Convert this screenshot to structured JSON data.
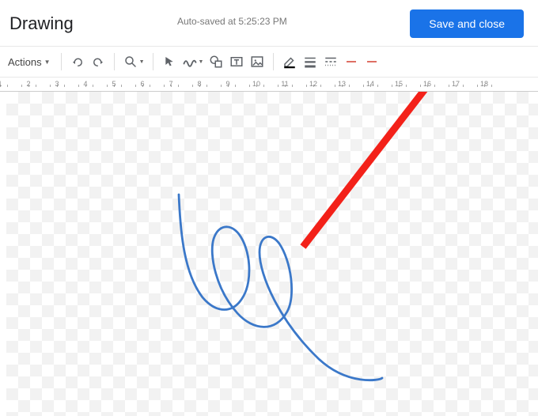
{
  "header": {
    "title": "Drawing",
    "autosave": "Auto-saved at 5:25:23 PM",
    "save_close": "Save and close"
  },
  "toolbar": {
    "actions": "Actions"
  },
  "ruler": {
    "start": 1,
    "end": 18
  }
}
